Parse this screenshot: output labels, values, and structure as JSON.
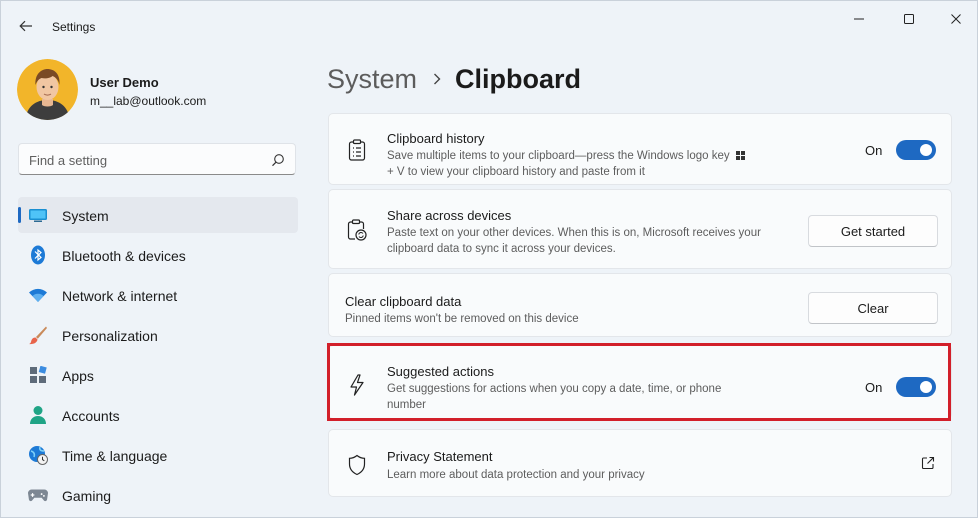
{
  "app": {
    "title": "Settings"
  },
  "user": {
    "name": "User Demo",
    "email": "m__lab@outlook.com"
  },
  "search": {
    "placeholder": "Find a setting"
  },
  "nav": {
    "items": [
      {
        "label": "System",
        "icon": "system-icon",
        "active": true
      },
      {
        "label": "Bluetooth & devices",
        "icon": "bluetooth-icon"
      },
      {
        "label": "Network & internet",
        "icon": "wifi-icon"
      },
      {
        "label": "Personalization",
        "icon": "brush-icon"
      },
      {
        "label": "Apps",
        "icon": "apps-icon"
      },
      {
        "label": "Accounts",
        "icon": "accounts-icon"
      },
      {
        "label": "Time & language",
        "icon": "globe-clock-icon"
      },
      {
        "label": "Gaming",
        "icon": "gamepad-icon"
      }
    ]
  },
  "breadcrumb": {
    "parent": "System",
    "current": "Clipboard"
  },
  "cards": {
    "history": {
      "title": "Clipboard history",
      "desc_line1": "Save multiple items to your clipboard—press the Windows logo key",
      "desc_line2": "+ V to view your clipboard history and paste from it",
      "toggle_label": "On"
    },
    "share": {
      "title": "Share across devices",
      "desc_line1": "Paste text on your other devices. When this is on, Microsoft receives your",
      "desc_line2": "clipboard data to sync it across your devices.",
      "button_label": "Get started"
    },
    "clear": {
      "title": "Clear clipboard data",
      "desc": "Pinned items won't be removed on this device",
      "button_label": "Clear"
    },
    "suggested": {
      "title": "Suggested actions",
      "desc_line1": "Get suggestions for actions when you copy a date, time, or phone",
      "desc_line2": "number",
      "toggle_label": "On"
    },
    "privacy": {
      "title": "Privacy Statement",
      "desc": "Learn more about data protection and your privacy"
    }
  },
  "colors": {
    "accent": "#1e69c2",
    "highlight": "#d21f2a",
    "background": "#eef3f8"
  }
}
